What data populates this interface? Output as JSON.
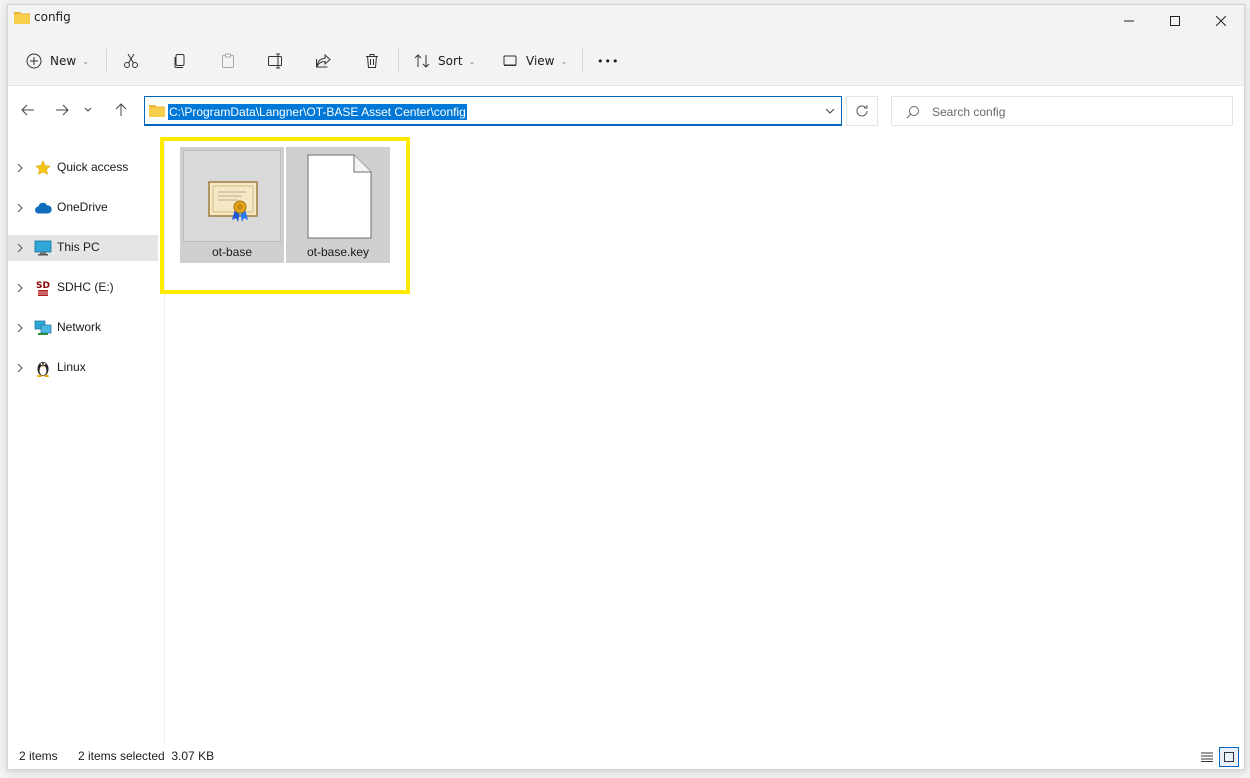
{
  "window": {
    "title": "config"
  },
  "toolbar": {
    "new_label": "New",
    "sort_label": "Sort",
    "view_label": "View",
    "more_label": "•••"
  },
  "address": {
    "path": "C:\\ProgramData\\Langner\\OT-BASE Asset Center\\config"
  },
  "search": {
    "placeholder": "Search config"
  },
  "sidebar": {
    "items": [
      {
        "label": "Quick access",
        "icon": "star-icon"
      },
      {
        "label": "OneDrive",
        "icon": "cloud-icon"
      },
      {
        "label": "This PC",
        "icon": "monitor-icon",
        "selected": true
      },
      {
        "label": "SDHC (E:)",
        "icon": "sd-card-icon"
      },
      {
        "label": "Network",
        "icon": "network-icon"
      },
      {
        "label": "Linux",
        "icon": "penguin-icon"
      }
    ]
  },
  "files": [
    {
      "name": "ot-base",
      "icon": "certificate-icon"
    },
    {
      "name": "ot-base.key",
      "icon": "blank-file-icon"
    }
  ],
  "status": {
    "item_count": "2 items",
    "selection": "2 items selected  3.07 KB"
  },
  "colors": {
    "accent": "#0067c0",
    "highlight": "#ffea00",
    "selection": "#0078d7"
  }
}
